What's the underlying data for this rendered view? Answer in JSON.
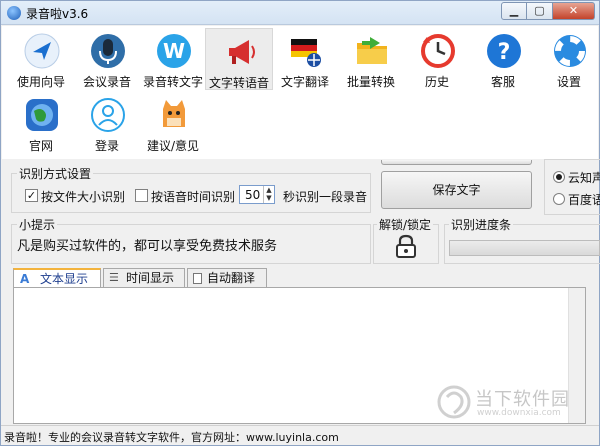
{
  "window": {
    "title": "录音啦v3.6"
  },
  "toolbar": {
    "items": [
      {
        "label": "使用向导",
        "icon": "compass-arrow-icon"
      },
      {
        "label": "会议录音",
        "icon": "microphone-icon"
      },
      {
        "label": "录音转文字",
        "icon": "w-logo-icon"
      },
      {
        "label": "文字转语音",
        "icon": "megaphone-icon",
        "selected": true
      },
      {
        "label": "文字翻译",
        "icon": "flag-globe-icon"
      },
      {
        "label": "批量转换",
        "icon": "folder-arrow-icon"
      },
      {
        "label": "历史",
        "icon": "history-clock-icon"
      },
      {
        "label": "客服",
        "icon": "help-question-icon"
      },
      {
        "label": "设置",
        "icon": "lifebuoy-icon"
      },
      {
        "label": "官网",
        "icon": "globe-icon"
      },
      {
        "label": "登录",
        "icon": "user-icon"
      },
      {
        "label": "建议/意见",
        "icon": "cat-mascot-icon"
      }
    ]
  },
  "recognition": {
    "group_title": "识别方式设置",
    "by_size_label": "按文件大小识别",
    "by_size_checked": true,
    "by_time_label": "按语音时间识别",
    "by_time_checked": false,
    "seconds_value": "50",
    "seconds_suffix": "秒识别一段录音"
  },
  "save_button": "保存文字",
  "engine": {
    "option1": "云知声",
    "option2": "百度语"
  },
  "tips": {
    "title": "小提示",
    "text": "凡是购买过软件的，都可以享受免费技术服务"
  },
  "lock": {
    "title": "解锁/锁定"
  },
  "progress": {
    "title": "识别进度条",
    "value": 0
  },
  "tabs": [
    {
      "label": "文本显示",
      "icon": "font-a-icon"
    },
    {
      "label": "时间显示",
      "icon": "list-icon"
    },
    {
      "label": "自动翻译",
      "icon": "page-icon"
    }
  ],
  "editor": {
    "content": ""
  },
  "status": {
    "text": "录音啦！专业的会议录音转文字软件，官方网址：www.luyinla.com"
  },
  "watermark": {
    "text": "当下软件园",
    "url": "www.downxia.com"
  }
}
